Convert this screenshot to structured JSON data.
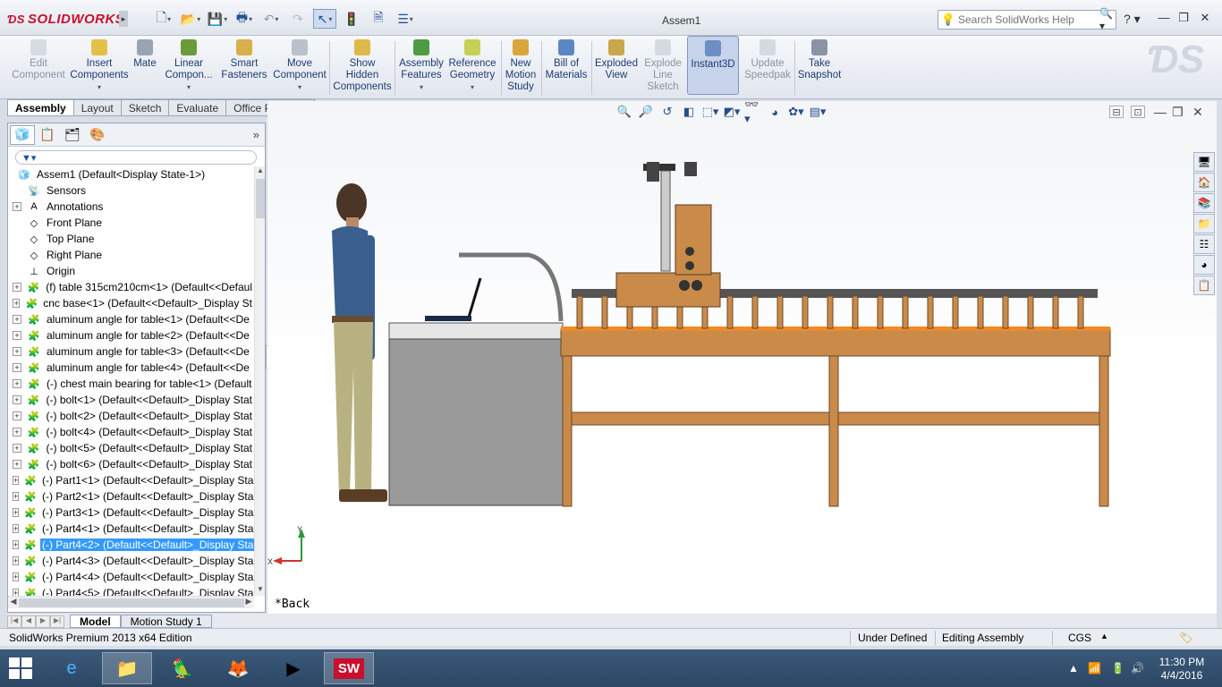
{
  "app": {
    "brand": "SOLIDWORKS",
    "document_title": "Assem1"
  },
  "search": {
    "placeholder": "Search SolidWorks Help"
  },
  "ribbon": {
    "buttons": [
      {
        "label": "Edit Component",
        "enabled": false
      },
      {
        "label": "Insert Components",
        "enabled": true
      },
      {
        "label": "Mate",
        "enabled": true
      },
      {
        "label": "Linear Compon...",
        "enabled": true
      },
      {
        "label": "Smart Fasteners",
        "enabled": true
      },
      {
        "label": "Move Component",
        "enabled": true
      },
      {
        "label": "Show Hidden Components",
        "enabled": true
      },
      {
        "label": "Assembly Features",
        "enabled": true
      },
      {
        "label": "Reference Geometry",
        "enabled": true
      },
      {
        "label": "New Motion Study",
        "enabled": true
      },
      {
        "label": "Bill of Materials",
        "enabled": true
      },
      {
        "label": "Exploded View",
        "enabled": true
      },
      {
        "label": "Explode Line Sketch",
        "enabled": false
      },
      {
        "label": "Instant3D",
        "enabled": true,
        "active": true
      },
      {
        "label": "Update Speedpak",
        "enabled": false
      },
      {
        "label": "Take Snapshot",
        "enabled": true
      }
    ]
  },
  "cm_tabs": [
    "Assembly",
    "Layout",
    "Sketch",
    "Evaluate",
    "Office Products"
  ],
  "cm_active_tab": "Assembly",
  "tree": {
    "root": "Assem1  (Default<Display State-1>)",
    "items": [
      {
        "label": "Sensors",
        "icon": "sensor-icon",
        "expandable": false
      },
      {
        "label": "Annotations",
        "icon": "annotations-icon",
        "expandable": true
      },
      {
        "label": "Front Plane",
        "icon": "plane-icon",
        "expandable": false
      },
      {
        "label": "Top Plane",
        "icon": "plane-icon",
        "expandable": false
      },
      {
        "label": "Right Plane",
        "icon": "plane-icon",
        "expandable": false
      },
      {
        "label": "Origin",
        "icon": "origin-icon",
        "expandable": false
      },
      {
        "label": "(f) table 315cm210cm<1> (Default<<Defaul",
        "icon": "part-icon",
        "expandable": true
      },
      {
        "label": "cnc base<1> (Default<<Default>_Display St",
        "icon": "part-icon",
        "expandable": true
      },
      {
        "label": "aluminum angle for table<1> (Default<<De",
        "icon": "part-icon",
        "expandable": true
      },
      {
        "label": "aluminum angle for table<2> (Default<<De",
        "icon": "part-icon",
        "expandable": true
      },
      {
        "label": "aluminum angle for table<3> (Default<<De",
        "icon": "part-icon",
        "expandable": true
      },
      {
        "label": "aluminum angle for table<4> (Default<<De",
        "icon": "part-icon",
        "expandable": true
      },
      {
        "label": "(-) chest main bearing for table<1> (Default",
        "icon": "part-icon",
        "expandable": true
      },
      {
        "label": "(-) bolt<1> (Default<<Default>_Display Stat",
        "icon": "part-icon",
        "expandable": true
      },
      {
        "label": "(-) bolt<2> (Default<<Default>_Display Stat",
        "icon": "part-icon",
        "expandable": true
      },
      {
        "label": "(-) bolt<4> (Default<<Default>_Display Stat",
        "icon": "part-icon",
        "expandable": true
      },
      {
        "label": "(-) bolt<5> (Default<<Default>_Display Stat",
        "icon": "part-icon",
        "expandable": true
      },
      {
        "label": "(-) bolt<6> (Default<<Default>_Display Stat",
        "icon": "part-icon",
        "expandable": true
      },
      {
        "label": "(-) Part1<1> (Default<<Default>_Display Sta",
        "icon": "part-icon",
        "expandable": true
      },
      {
        "label": "(-) Part2<1> (Default<<Default>_Display Sta",
        "icon": "part-icon",
        "expandable": true
      },
      {
        "label": "(-) Part3<1> (Default<<Default>_Display Sta",
        "icon": "part-icon",
        "expandable": true
      },
      {
        "label": "(-) Part4<1> (Default<<Default>_Display Sta",
        "icon": "part-icon",
        "expandable": true
      },
      {
        "label": "(-) Part4<2> (Default<<Default>_Display Sta",
        "icon": "part-icon",
        "expandable": true,
        "selected": true
      },
      {
        "label": "(-) Part4<3> (Default<<Default>_Display Sta",
        "icon": "part-icon",
        "expandable": true
      },
      {
        "label": "(-) Part4<4> (Default<<Default>_Display Sta",
        "icon": "part-icon",
        "expandable": true
      },
      {
        "label": "(-) Part4<5> (Default<<Default>_Display Sta",
        "icon": "part-icon",
        "expandable": true
      }
    ]
  },
  "viewport": {
    "view_label": "*Back",
    "triad_x": "X",
    "triad_y": "Y"
  },
  "bottom_tabs": [
    "Model",
    "Motion Study 1"
  ],
  "status": {
    "edition": "SolidWorks Premium 2013 x64 Edition",
    "definition": "Under Defined",
    "mode": "Editing Assembly",
    "units": "CGS"
  },
  "taskbar": {
    "time": "11:30 PM",
    "date": "4/4/2016"
  },
  "colors": {
    "accent": "#3399ff",
    "wood": "#c98a4a",
    "orange_strip": "#f08a24"
  }
}
